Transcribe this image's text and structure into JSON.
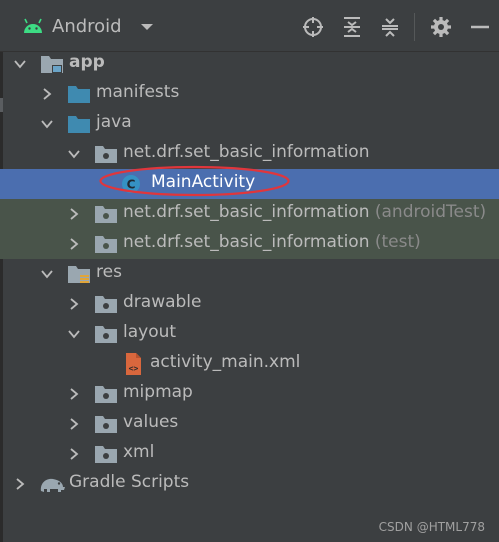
{
  "toolbar": {
    "title": "Android",
    "icons": [
      "android-icon",
      "chevron-down-icon",
      "locate-icon",
      "expand-all-icon",
      "collapse-all-icon",
      "gear-icon",
      "minimize-icon"
    ]
  },
  "tree": {
    "app": "app",
    "manifests": "manifests",
    "java": "java",
    "pkg_main": "net.drf.set_basic_information",
    "main_activity": "MainActivity",
    "pkg_android_test": "net.drf.set_basic_information",
    "android_test_suffix": "(androidTest)",
    "pkg_test": "net.drf.set_basic_information",
    "test_suffix": "(test)",
    "res": "res",
    "drawable": "drawable",
    "layout": "layout",
    "activity_main": "activity_main.xml",
    "mipmap": "mipmap",
    "values": "values",
    "xml": "xml",
    "gradle_scripts": "Gradle Scripts"
  },
  "colors": {
    "background": "#3c3f41",
    "selection": "#4b6eaf",
    "test_row": "#49544a",
    "folder_blue": "#3f8ab0",
    "folder_gray": "#9aa7b0",
    "android_green": "#3ddc84",
    "annotation": "#e0363c"
  },
  "watermark": "CSDN @HTML778"
}
